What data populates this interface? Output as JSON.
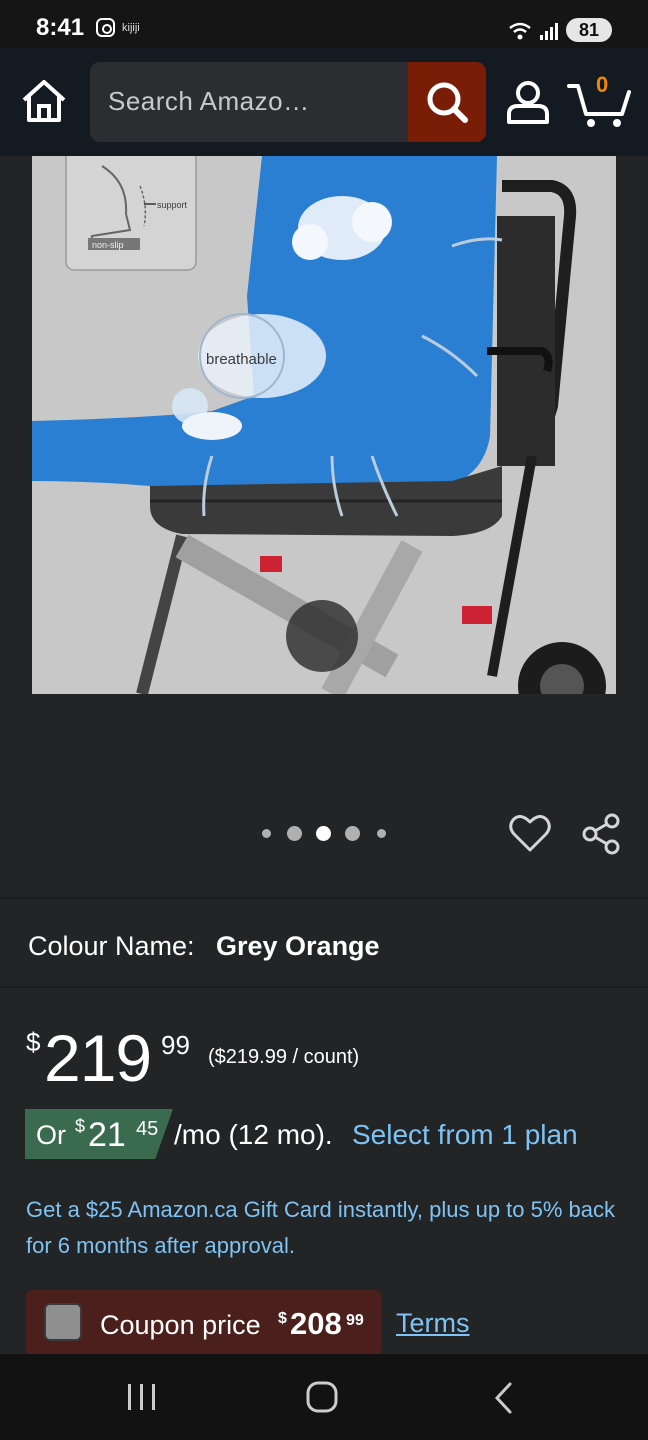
{
  "status_bar": {
    "time": "8:41",
    "notification_app": "kijiji",
    "battery": "81"
  },
  "header": {
    "search_placeholder": "Search Amazo…",
    "cart_count": "0",
    "icons": [
      "home-icon",
      "search-icon",
      "account-icon",
      "cart-icon"
    ]
  },
  "product_image": {
    "labels": {
      "support": "support",
      "non_slip": "non-slip",
      "breathable": "breathable"
    },
    "gallery_dots": 5,
    "active_dot": 3
  },
  "colour": {
    "label": "Colour Name:",
    "value": "Grey Orange"
  },
  "price": {
    "currency_symbol": "$",
    "whole": "219",
    "fraction": "99",
    "unit_price": "($219.99 / count)"
  },
  "monthly": {
    "or": "Or",
    "currency_symbol": "$",
    "whole": "21",
    "fraction": "45",
    "rest": "/mo (12 mo).",
    "plan_link": "Select from 1 plan"
  },
  "gift_card_text": "Get a $25 Amazon.ca Gift Card instantly, plus up to 5% back for 6 months after approval.",
  "coupon": {
    "label": "Coupon price",
    "currency_symbol": "$",
    "whole": "208",
    "fraction": "99",
    "terms": "Terms"
  },
  "colors": {
    "header_bg": "#131a22",
    "search_button": "#7a1d06",
    "cart_count": "#f08804",
    "link": "#7ec3f3",
    "monthly_badge": "#3a6b4f",
    "coupon_bg": "#4a1f1c"
  }
}
